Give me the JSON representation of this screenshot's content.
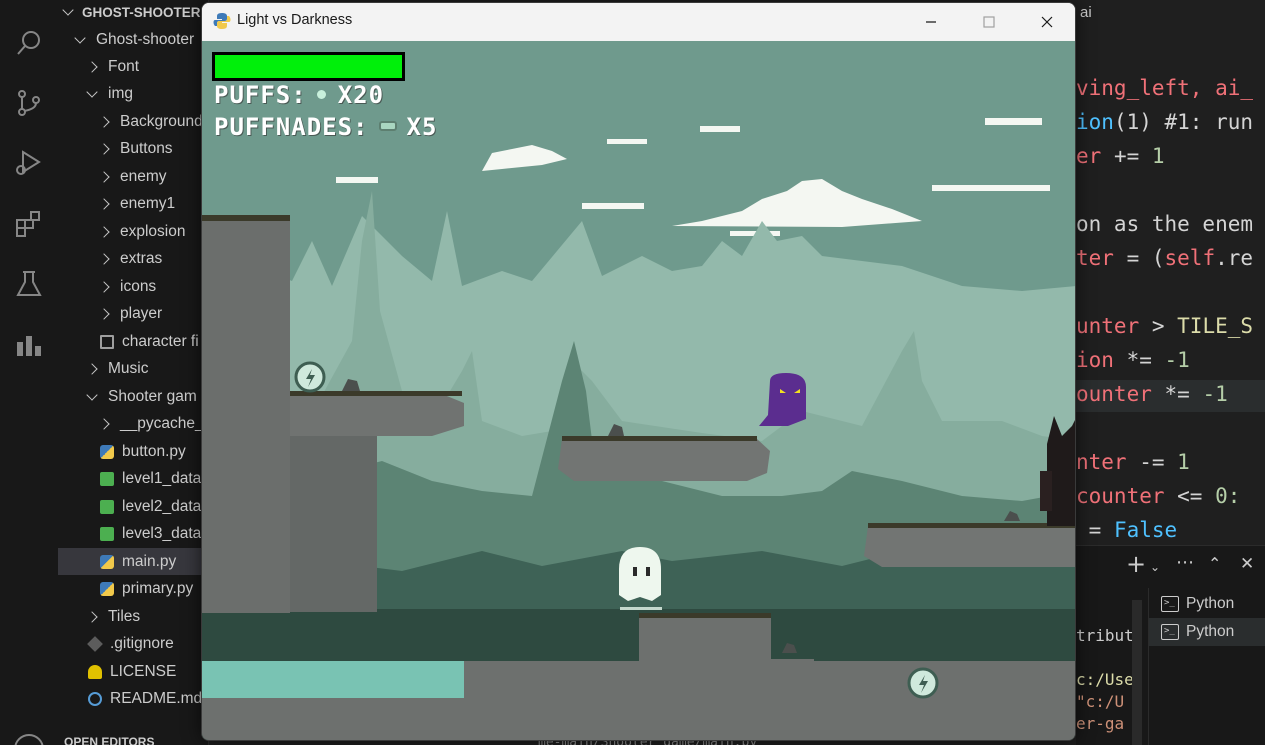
{
  "explorer": {
    "root_label": "GHOST-SHOOTER",
    "items": [
      {
        "label": "Ghost-shooter",
        "kind": "folder-open",
        "depth": 1
      },
      {
        "label": "Font",
        "kind": "folder",
        "depth": 2
      },
      {
        "label": "img",
        "kind": "folder-open",
        "depth": 2
      },
      {
        "label": "Background",
        "kind": "folder",
        "depth": 3
      },
      {
        "label": "Buttons",
        "kind": "folder",
        "depth": 3
      },
      {
        "label": "enemy",
        "kind": "folder",
        "depth": 3
      },
      {
        "label": "enemy1",
        "kind": "folder",
        "depth": 3
      },
      {
        "label": "explosion",
        "kind": "folder",
        "depth": 3
      },
      {
        "label": "extras",
        "kind": "folder",
        "depth": 3
      },
      {
        "label": "icons",
        "kind": "folder",
        "depth": 3
      },
      {
        "label": "player",
        "kind": "folder",
        "depth": 3
      },
      {
        "label": "character fi",
        "kind": "txt",
        "depth": 3
      },
      {
        "label": "Music",
        "kind": "folder",
        "depth": 2
      },
      {
        "label": "Shooter gam",
        "kind": "folder-open",
        "depth": 2
      },
      {
        "label": "__pycache_",
        "kind": "folder",
        "depth": 3
      },
      {
        "label": "button.py",
        "kind": "py",
        "depth": 3
      },
      {
        "label": "level1_data",
        "kind": "csv",
        "depth": 3
      },
      {
        "label": "level2_data",
        "kind": "csv",
        "depth": 3
      },
      {
        "label": "level3_data",
        "kind": "csv",
        "depth": 3
      },
      {
        "label": "main.py",
        "kind": "py",
        "depth": 3,
        "active": true
      },
      {
        "label": "primary.py",
        "kind": "py",
        "depth": 3
      },
      {
        "label": "Tiles",
        "kind": "folder",
        "depth": 2
      },
      {
        "label": ".gitignore",
        "kind": "git",
        "depth": 2
      },
      {
        "label": "LICENSE",
        "kind": "lic",
        "depth": 2
      },
      {
        "label": "README.md",
        "kind": "info",
        "depth": 2
      }
    ],
    "open_editors_label": "OPEN EDITORS"
  },
  "editor": {
    "tab_fragment": "ai",
    "code_lines": [
      {
        "segments": [
          {
            "t": "ving_left, ai_",
            "c": "kw-red"
          }
        ]
      },
      {
        "segments": [
          {
            "t": "ion",
            "c": "kw-blue"
          },
          {
            "t": "(1) ",
            "c": "kw-op"
          },
          {
            "t": "#1: run",
            "c": "kw-op"
          }
        ]
      },
      {
        "segments": [
          {
            "t": "er ",
            "c": "kw-red"
          },
          {
            "t": "+= ",
            "c": "kw-op"
          },
          {
            "t": "1",
            "c": "kw-num"
          }
        ]
      },
      {
        "segments": [
          {
            "t": "on as the enem",
            "c": "kw-op"
          }
        ]
      },
      {
        "segments": [
          {
            "t": "ter ",
            "c": "kw-red"
          },
          {
            "t": "= (",
            "c": "kw-op"
          },
          {
            "t": "self",
            "c": "kw-red"
          },
          {
            "t": ".re",
            "c": "kw-op"
          }
        ]
      },
      {
        "segments": [
          {
            "t": "unter ",
            "c": "kw-red"
          },
          {
            "t": "> ",
            "c": "kw-op"
          },
          {
            "t": "TILE_S",
            "c": "kw-yel"
          }
        ]
      },
      {
        "segments": [
          {
            "t": "ion ",
            "c": "kw-red"
          },
          {
            "t": "*= ",
            "c": "kw-op"
          },
          {
            "t": "-1",
            "c": "kw-num"
          }
        ]
      },
      {
        "segments": [
          {
            "t": "ounter ",
            "c": "kw-red"
          },
          {
            "t": "*= ",
            "c": "kw-op"
          },
          {
            "t": "-1",
            "c": "kw-num"
          }
        ]
      },
      {
        "segments": [
          {
            "t": "nter ",
            "c": "kw-red"
          },
          {
            "t": "-= ",
            "c": "kw-op"
          },
          {
            "t": "1",
            "c": "kw-num"
          }
        ]
      },
      {
        "segments": [
          {
            "t": "counter ",
            "c": "kw-red"
          },
          {
            "t": "<= ",
            "c": "kw-op"
          },
          {
            "t": "0:",
            "c": "kw-num"
          }
        ]
      },
      {
        "segments": [
          {
            "t": " = ",
            "c": "kw-op"
          },
          {
            "t": "False",
            "c": "kw-const"
          }
        ]
      }
    ]
  },
  "panel": {
    "terminals": [
      "Python",
      "Python"
    ],
    "selected_terminal": 1,
    "text_fragments": [
      {
        "t": "tribut",
        "c": "#cccccc"
      },
      {
        "t": "c:/Use",
        "c": "#dcdcaa"
      },
      {
        "t": "\"c:/U",
        "c": "#ce9178"
      },
      {
        "t": "er-ga",
        "c": "#ce9178"
      }
    ],
    "bottom_path": "me-main/Shooter game/main.py\""
  },
  "window": {
    "title": "Light vs Darkness",
    "buttons": [
      "minimize",
      "maximize",
      "close"
    ]
  },
  "game": {
    "health_fraction": 1.0,
    "health_color": "#00f00a",
    "hud": {
      "puffs_label": "PUFFS:",
      "puffs_count": "X20",
      "puffnades_label": "PUFFNADES:",
      "puffnades_count": "X5"
    },
    "colors": {
      "sky": "#6f9a8d",
      "far_mountains": "#93b9ab",
      "mid_trees": "#4f7a6c",
      "dark_trees": "#2e4a40",
      "rock": "#6b6e6c",
      "water": "#79c3b3",
      "player": "#eef7ee",
      "enemy": "#5b2d8f"
    }
  }
}
